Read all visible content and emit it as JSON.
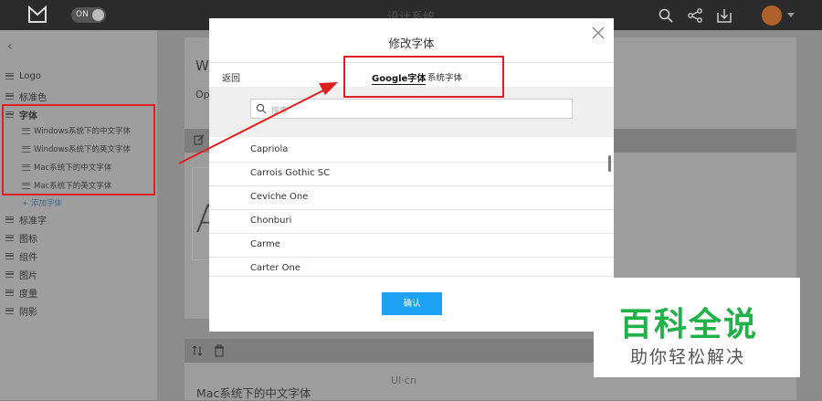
{
  "topbar": {
    "toggle": "ON",
    "title": "设计系统"
  },
  "sidebar": {
    "back": "‹",
    "items": [
      {
        "label": "Logo"
      },
      {
        "label": "标准色"
      },
      {
        "label": "字体"
      },
      {
        "label": "标准字"
      },
      {
        "label": "图标"
      },
      {
        "label": "组件"
      },
      {
        "label": "图片"
      },
      {
        "label": "度量"
      },
      {
        "label": "阴影"
      }
    ],
    "subitems": [
      {
        "label": "Windows系统下的中文字体"
      },
      {
        "label": "Windows系统下的英文字体"
      },
      {
        "label": "Mac系统下的中文字体"
      },
      {
        "label": "Mac系统下的英文字体"
      }
    ],
    "add_label": "+ 添加字体"
  },
  "background": {
    "heading_w": "W",
    "text_op": "Op",
    "big_letter": "A",
    "bottom_label": "Mac系统下的中文字体"
  },
  "modal": {
    "title": "修改字体",
    "back": "返回",
    "tabs": [
      {
        "label": "Google字体"
      },
      {
        "label": "系统字体"
      }
    ],
    "search_placeholder": "搜索",
    "fonts": [
      {
        "name": "Capriola"
      },
      {
        "name": "Carrois Gothic SC"
      },
      {
        "name": "Ceviche One"
      },
      {
        "name": "Chonburi"
      },
      {
        "name": "Carme"
      },
      {
        "name": "Carter One"
      }
    ],
    "confirm": "确认"
  },
  "watermark": {
    "main": "百科全说",
    "sub": "助你轻松解决"
  },
  "site_mark": "UI·cn",
  "colors": {
    "accent": "#1da1f2",
    "highlight": "#e02020",
    "brand_green": "#22b04a"
  }
}
